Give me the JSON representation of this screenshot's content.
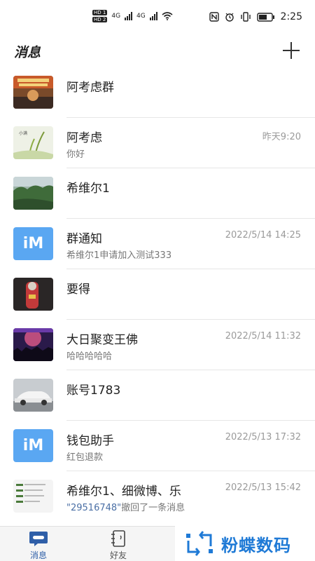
{
  "status_bar": {
    "hd1": "HD 1",
    "hd2": "HD 2",
    "net1": "4G",
    "net2": "4G",
    "time": "2:25"
  },
  "header": {
    "title": "消息",
    "add_icon": "plus-icon"
  },
  "conversations": [
    {
      "name": "阿考虑群",
      "preview": "",
      "time": "",
      "avatar": "poster-thumbnail"
    },
    {
      "name": "阿考虑",
      "preview": "你好",
      "time": "昨天9:20",
      "avatar": "grain-illustration-thumbnail"
    },
    {
      "name": "希维尔1",
      "preview": "",
      "time": "",
      "avatar": "forest-photo-thumbnail"
    },
    {
      "name": "群通知",
      "preview": "希维尔1申请加入测试333",
      "time": "2022/5/14 14:25",
      "avatar": "im-logo"
    },
    {
      "name": "要得",
      "preview": "",
      "time": "",
      "avatar": "toy-figure-thumbnail"
    },
    {
      "name": "大日聚变王佛",
      "preview": "哈哈哈哈哈",
      "time": "2022/5/14 11:32",
      "avatar": "concert-photo-thumbnail"
    },
    {
      "name": "账号1783",
      "preview": "",
      "time": "",
      "avatar": "car-photo-thumbnail"
    },
    {
      "name": "钱包助手",
      "preview": "红包退款",
      "time": "2022/5/13 17:32",
      "avatar": "im-logo"
    },
    {
      "name": "希维尔1、细微博、乐",
      "preview_quote": "\"29516748\"",
      "preview": "撤回了一条消息",
      "time": "2022/5/13 15:42",
      "avatar": "app-screenshot-thumbnail"
    }
  ],
  "im_logo_text": "iM",
  "tabbar": {
    "messages_label": "消息",
    "friends_label": "好友"
  },
  "watermark": {
    "text": "粉蝶数码"
  }
}
